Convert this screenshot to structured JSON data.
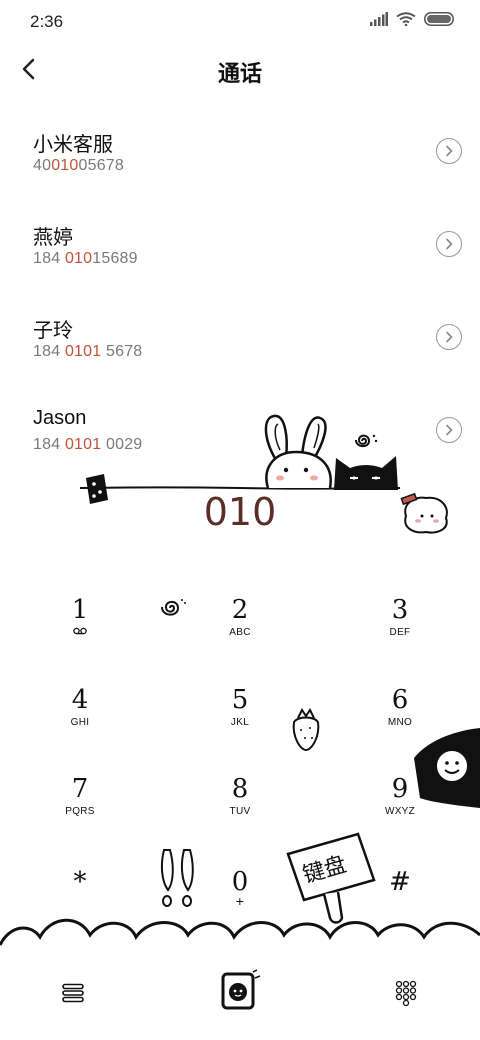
{
  "status": {
    "time": "2:36"
  },
  "header": {
    "title": "通话"
  },
  "results": [
    {
      "name": "小米客服",
      "number_parts": [
        "40",
        "010",
        "05678"
      ]
    },
    {
      "name": "燕婷",
      "number_parts": [
        "184 ",
        "010",
        "15689"
      ]
    },
    {
      "name": "子玲",
      "number_parts": [
        "184 ",
        "0101",
        " 5678"
      ]
    },
    {
      "name": "Jason",
      "number_parts": [
        "184 ",
        "0101",
        " 0029"
      ]
    }
  ],
  "dialed_number": "010",
  "keypad": {
    "keys": [
      {
        "digit": "1",
        "letters": "voicemail-icon"
      },
      {
        "digit": "2",
        "letters": "ABC"
      },
      {
        "digit": "3",
        "letters": "DEF"
      },
      {
        "digit": "4",
        "letters": "GHI"
      },
      {
        "digit": "5",
        "letters": "JKL"
      },
      {
        "digit": "6",
        "letters": "MNO"
      },
      {
        "digit": "7",
        "letters": "PQRS"
      },
      {
        "digit": "8",
        "letters": "TUV"
      },
      {
        "digit": "9",
        "letters": "WXYZ"
      },
      {
        "digit": "*",
        "letters": ""
      },
      {
        "digit": "0",
        "letters": "+"
      },
      {
        "digit": "#",
        "letters": ""
      }
    ]
  },
  "sign_text": "键盘",
  "colors": {
    "highlight": "#c0533a",
    "dialed": "#5a2f2a"
  }
}
